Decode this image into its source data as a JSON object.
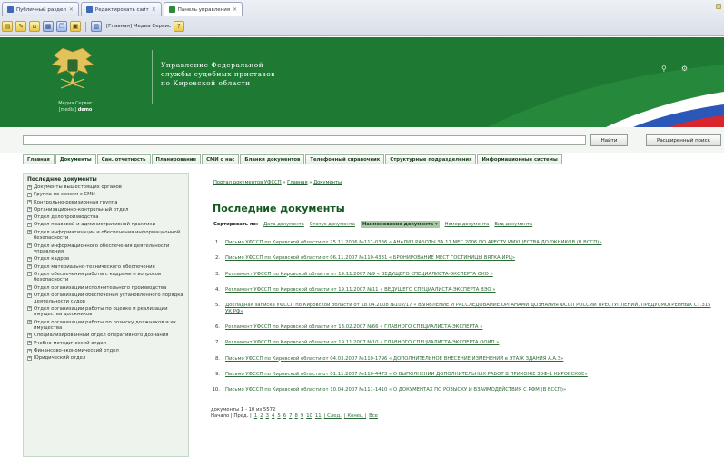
{
  "browser": {
    "tabs": [
      {
        "label": "Публичный раздел",
        "active": false
      },
      {
        "label": "Редактировать сайт",
        "active": false
      },
      {
        "label": "Панель управления",
        "active": true
      }
    ],
    "toolbar_text": "[Главная] Медиа Сервис"
  },
  "header": {
    "title_lines": [
      "Управление Федеральной",
      "службы судебных приставов",
      "по Кировской области"
    ],
    "caption_line1": "Медиа Сервис",
    "caption_line2": "[media]",
    "caption_bold": "demo"
  },
  "search": {
    "value": "",
    "search_button": "Найти",
    "advanced_button": "Расширенный поиск"
  },
  "nav": {
    "items": [
      "Главная",
      "Документы",
      "Сан. отчетность",
      "Планирование",
      "СМИ о нас",
      "Бланки документов",
      "Телефонный справочник",
      "Структурные подразделения",
      "Информационные системы"
    ]
  },
  "sidebar": {
    "title": "Последние документы",
    "items": [
      "Документы вышестоящих органов",
      "Группа по связям с СМИ",
      "Контрольно-ревизионная группа",
      "Организационно-контрольный отдел",
      "Отдел делопроизводства",
      "Отдел правовой и административной практики",
      "Отдел информатизации и обеспечения информационной безопасности",
      "Отдел информационного обеспечения деятельности управления",
      "Отдел кадров",
      "Отдел материально-технического обеспечения",
      "Отдел обеспечения работы с кадрами и вопросов безопасности",
      "Отдел организации исполнительного производства",
      "Отдел организации обеспечения установленного порядка деятельности судов",
      "Отдел организации работы по оценке и реализации имущества должников",
      "Отдел организации работы по розыску должников и их имущества",
      "Специализированный отдел оперативного дознания",
      "Учебно-методический отдел",
      "Финансово-экономический отдел",
      "Юридический отдел"
    ]
  },
  "main": {
    "breadcrumb_link": "Портал документов УФССП",
    "breadcrumb_home": "Главная",
    "breadcrumb_current": "Документы",
    "title": "Последние документы",
    "sort_label": "Сортировать по:",
    "sort_options": [
      {
        "label": "Дата документа",
        "active": false
      },
      {
        "label": "Статус документа",
        "active": false
      },
      {
        "label": "Наименование документа ▾",
        "active": true
      },
      {
        "label": "Номер документа",
        "active": false
      },
      {
        "label": "Вид документа",
        "active": false
      }
    ],
    "documents": [
      {
        "num": "1.",
        "text": "Письмо УФССП по Кировской области от 25.11.2006 №111-0336 « АНАЛИЗ РАБОТЫ ЗА 11 МЕС 2006 ПО АРЕСТУ ИМУЩЕСТВА ДОЛЖНИКОВ (В ВССП)»"
      },
      {
        "num": "2.",
        "text": "Письмо УФССП по Кировской области от 06.11.2007 №110-4331 « БРОНИРОВАНИЕ МЕСТ ГОСТИНИЦЫ ВЯТКА-ИРЦ»"
      },
      {
        "num": "3.",
        "text": "Регламент УФССП по Кировской области от 19.11.2007 №9 « ВЕДУЩЕГО СПЕЦИАЛИСТА-ЭКСПЕРТА ОКО »"
      },
      {
        "num": "4.",
        "text": "Регламент УФССП по Кировской области от 19.11.2007 №11 « ВЕДУЩЕГО СПЕЦИАЛИСТА-ЭКСПЕРТА ВЭО »"
      },
      {
        "num": "5.",
        "text": "Докладная записка УФССП по Кировской области от 18.04.2008 №102/17 « ВЫЯВЛЕНИЕ И РАССЛЕДОВАНИЕ ОРГАНАМИ ДОЗНАНИЯ ФССП РОССИИ ПРЕСТУПЛЕНИЙ, ПРЕДУСМОТРЕННЫХ СТ.315 УК РФ»"
      },
      {
        "num": "6.",
        "text": "Регламент УФССП по Кировской области от 13.02.2007 №66 « ГЛАВНОГО СПЕЦИАЛИСТА-ЭКСПЕРТА »"
      },
      {
        "num": "7.",
        "text": "Регламент УФССП по Кировской области от 19.11.2007 №10 « ГЛАВНОГО СПЕЦИАЛИСТА-ЭКСПЕРТА ООИП »"
      },
      {
        "num": "8.",
        "text": "Письмо УФССП по Кировской области от 04.03.2007 №110-1796 « ДОПОЛНИТЕЛЬНОЕ ВНЕСЕНИЕ ИЗМЕНЕНИЙ в ЭТАЖ ЗДАНИЯ А.А.З»"
      },
      {
        "num": "9.",
        "text": "Письмо УФССП по Кировской области от 01.11.2007 №110-4473 « О ВЫПОЛНЕНИИ ДОПОЛНИТЕЛЬНЫХ РАБОТ В ПРИХОЖЕ 3ЭФ-1 КИРОВСКОЕ»"
      },
      {
        "num": "10.",
        "text": "Письмо УФССП по Кировской области от 10.04.2007 №111-1410 « О ДОКУМЕНТАХ ПО РОЗЫСКУ И ВЗАИМОДЕЙСТВИЯ С РФМ (В ВССП)»"
      }
    ],
    "count_text": "документы 1 - 10 из 5572",
    "pager_label": "Начало | Пред. |",
    "pager_pages": [
      "1",
      "2",
      "3",
      "4",
      "5",
      "6",
      "7",
      "8",
      "9",
      "10",
      "11"
    ],
    "pager_next": "| След.",
    "pager_end": "| Конец |",
    "pager_all": "Все"
  }
}
